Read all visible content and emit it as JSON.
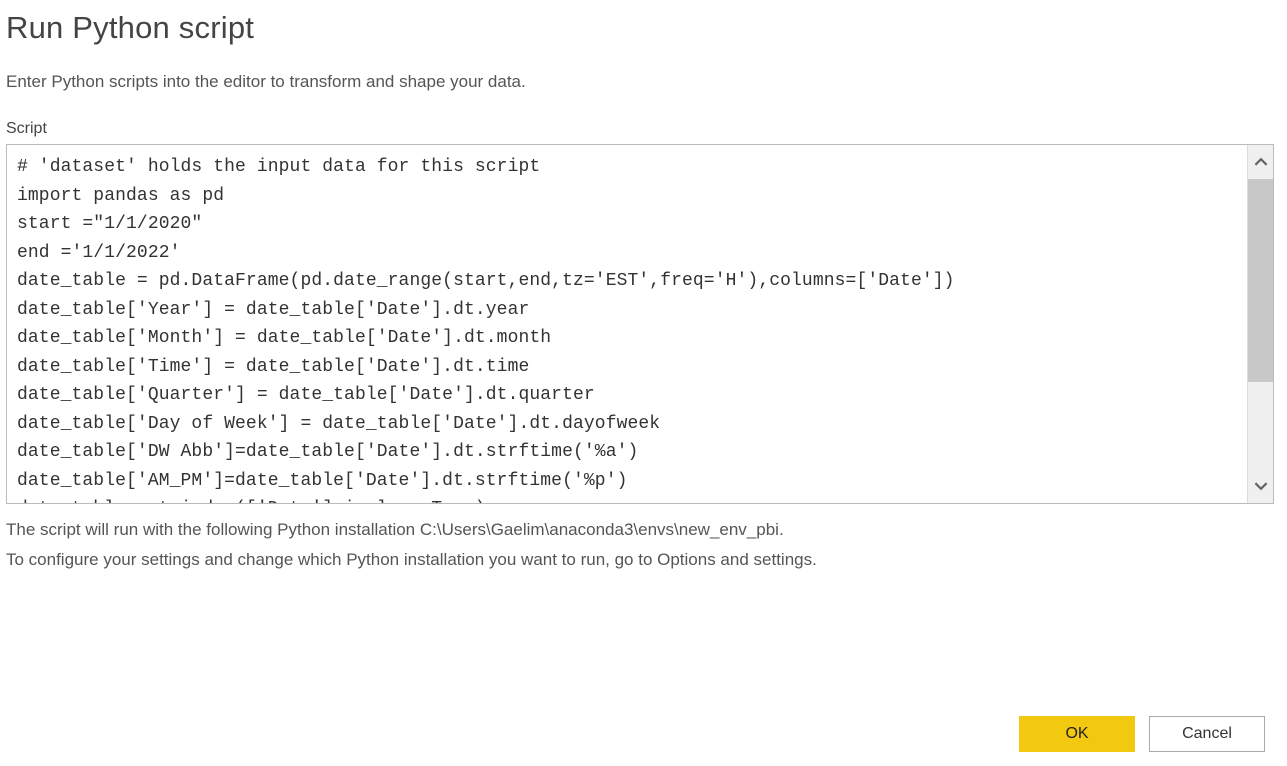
{
  "dialog": {
    "title": "Run Python script",
    "subtitle": "Enter Python scripts into the editor to transform and shape your data.",
    "script_label": "Script",
    "script_value": "# 'dataset' holds the input data for this script\nimport pandas as pd\nstart =\"1/1/2020\"\nend ='1/1/2022'\ndate_table = pd.DataFrame(pd.date_range(start,end,tz='EST',freq='H'),columns=['Date'])\ndate_table['Year'] = date_table['Date'].dt.year\ndate_table['Month'] = date_table['Date'].dt.month\ndate_table['Time'] = date_table['Date'].dt.time\ndate_table['Quarter'] = date_table['Date'].dt.quarter\ndate_table['Day of Week'] = date_table['Date'].dt.dayofweek\ndate_table['DW Abb']=date_table['Date'].dt.strftime('%a')\ndate_table['AM_PM']=date_table['Date'].dt.strftime('%p')\ndate_table.set_index(['Date'],inplace=True)",
    "info_installation": "The script will run with the following Python installation C:\\Users\\Gaelim\\anaconda3\\envs\\new_env_pbi.",
    "info_configure": "To configure your settings and change which Python installation you want to run, go to Options and settings.",
    "ok_label": "OK",
    "cancel_label": "Cancel"
  }
}
